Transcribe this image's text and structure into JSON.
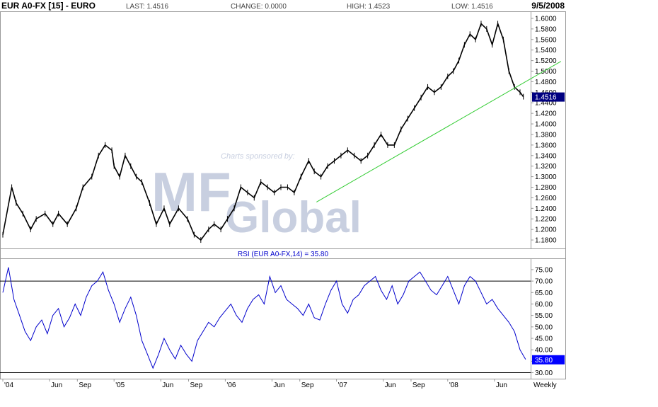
{
  "header": {
    "symbol": "EUR A0-FX [15] - EURO",
    "last": "LAST: 1.4516",
    "change": "CHANGE: 0.0000",
    "high": "HIGH: 1.4523",
    "low": "LOW: 1.4516",
    "date": "9/5/2008"
  },
  "watermark": {
    "sponsor_text": "Charts sponsored by:",
    "logo_letters": "MF",
    "logo_word": "Global"
  },
  "rsi_label": "RSI (EUR A0-FX,14) = 35.80",
  "x_axis_labels": [
    {
      "label": "'04",
      "t": 0.0
    },
    {
      "label": "Jun",
      "t": 0.42
    },
    {
      "label": "Sep",
      "t": 0.67
    },
    {
      "label": "'05",
      "t": 1.0
    },
    {
      "label": "Jun",
      "t": 1.42
    },
    {
      "label": "Sep",
      "t": 1.67
    },
    {
      "label": "'06",
      "t": 2.0
    },
    {
      "label": "Jun",
      "t": 2.42
    },
    {
      "label": "Sep",
      "t": 2.67
    },
    {
      "label": "'07",
      "t": 3.0
    },
    {
      "label": "Jun",
      "t": 3.42
    },
    {
      "label": "Sep",
      "t": 3.67
    },
    {
      "label": "'08",
      "t": 4.0
    },
    {
      "label": "Jun",
      "t": 4.42
    }
  ],
  "period_label": "Weekly",
  "colors": {
    "price": "#000000",
    "trendline": "#33cc33",
    "rsi_line": "#0000cc",
    "last_tag_bg": "#000080",
    "rsi_tag_bg": "#0000ff",
    "watermark": "#c8cfe0",
    "frame": "#999999"
  },
  "chart_data": [
    {
      "type": "line",
      "title": "EUR A0-FX [15] - EURO",
      "x_unit": "years since Jan 2004 (weekly bars)",
      "ylim": [
        1.168,
        1.608
      ],
      "y_ticks": [
        1.18,
        1.2,
        1.22,
        1.24,
        1.26,
        1.28,
        1.3,
        1.32,
        1.34,
        1.36,
        1.38,
        1.4,
        1.42,
        1.44,
        1.46,
        1.48,
        1.5,
        1.52,
        1.54,
        1.56,
        1.58,
        1.6
      ],
      "last_value": 1.4516,
      "series": [
        {
          "name": "EUR A0-FX",
          "x": [
            0,
            0.08,
            0.12,
            0.18,
            0.25,
            0.3,
            0.38,
            0.45,
            0.5,
            0.58,
            0.66,
            0.72,
            0.8,
            0.86,
            0.92,
            0.98,
            1.0,
            1.05,
            1.1,
            1.15,
            1.2,
            1.25,
            1.32,
            1.38,
            1.45,
            1.5,
            1.58,
            1.66,
            1.72,
            1.78,
            1.85,
            1.9,
            1.96,
            2.02,
            2.08,
            2.14,
            2.2,
            2.26,
            2.32,
            2.38,
            2.44,
            2.5,
            2.56,
            2.62,
            2.68,
            2.75,
            2.8,
            2.86,
            2.92,
            2.98,
            3.04,
            3.1,
            3.16,
            3.22,
            3.28,
            3.34,
            3.4,
            3.46,
            3.52,
            3.58,
            3.64,
            3.7,
            3.76,
            3.82,
            3.88,
            3.94,
            4.0,
            4.05,
            4.1,
            4.15,
            4.2,
            4.25,
            4.3,
            4.35,
            4.4,
            4.45,
            4.5,
            4.55,
            4.6,
            4.65,
            4.68
          ],
          "values": [
            1.19,
            1.28,
            1.25,
            1.23,
            1.2,
            1.22,
            1.23,
            1.21,
            1.23,
            1.21,
            1.24,
            1.28,
            1.3,
            1.34,
            1.36,
            1.35,
            1.32,
            1.3,
            1.34,
            1.32,
            1.3,
            1.29,
            1.25,
            1.21,
            1.24,
            1.21,
            1.24,
            1.22,
            1.19,
            1.18,
            1.2,
            1.21,
            1.2,
            1.22,
            1.24,
            1.28,
            1.27,
            1.26,
            1.29,
            1.28,
            1.27,
            1.28,
            1.28,
            1.27,
            1.3,
            1.33,
            1.31,
            1.3,
            1.32,
            1.33,
            1.34,
            1.35,
            1.34,
            1.33,
            1.34,
            1.36,
            1.38,
            1.36,
            1.36,
            1.39,
            1.41,
            1.43,
            1.45,
            1.47,
            1.46,
            1.47,
            1.49,
            1.5,
            1.52,
            1.55,
            1.57,
            1.56,
            1.59,
            1.58,
            1.55,
            1.59,
            1.56,
            1.5,
            1.47,
            1.46,
            1.4516
          ]
        },
        {
          "name": "Trendline",
          "x": [
            2.82,
            4.7
          ],
          "values": [
            1.252,
            1.48
          ]
        }
      ]
    },
    {
      "type": "line",
      "title": "RSI (EUR A0-FX,14) = 35.80",
      "ylim": [
        28,
        79
      ],
      "y_ticks": [
        30,
        35,
        40,
        45,
        50,
        55,
        60,
        65,
        70,
        75
      ],
      "reference_lines": [
        70,
        30
      ],
      "last_value": 35.8,
      "series": [
        {
          "name": "RSI (EUR A0-FX,14)",
          "x": [
            0,
            0.05,
            0.1,
            0.15,
            0.2,
            0.25,
            0.3,
            0.35,
            0.4,
            0.45,
            0.5,
            0.55,
            0.6,
            0.65,
            0.7,
            0.75,
            0.8,
            0.85,
            0.9,
            0.95,
            1.0,
            1.05,
            1.1,
            1.15,
            1.2,
            1.25,
            1.3,
            1.35,
            1.4,
            1.45,
            1.5,
            1.55,
            1.6,
            1.65,
            1.7,
            1.75,
            1.8,
            1.85,
            1.9,
            1.95,
            2.0,
            2.05,
            2.1,
            2.15,
            2.2,
            2.25,
            2.3,
            2.35,
            2.4,
            2.45,
            2.5,
            2.55,
            2.6,
            2.65,
            2.7,
            2.75,
            2.8,
            2.85,
            2.9,
            2.95,
            3.0,
            3.05,
            3.1,
            3.15,
            3.2,
            3.25,
            3.3,
            3.35,
            3.4,
            3.45,
            3.5,
            3.55,
            3.6,
            3.65,
            3.7,
            3.75,
            3.8,
            3.85,
            3.9,
            3.95,
            4.0,
            4.05,
            4.1,
            4.15,
            4.2,
            4.25,
            4.3,
            4.35,
            4.4,
            4.45,
            4.5,
            4.55,
            4.6,
            4.65,
            4.7
          ],
          "values": [
            65,
            76,
            62,
            55,
            48,
            44,
            50,
            53,
            47,
            55,
            58,
            50,
            54,
            60,
            55,
            63,
            68,
            70,
            74,
            66,
            60,
            52,
            58,
            63,
            55,
            44,
            38,
            32,
            38,
            45,
            40,
            36,
            42,
            38,
            35,
            44,
            48,
            52,
            50,
            54,
            57,
            60,
            55,
            52,
            58,
            62,
            64,
            60,
            72,
            65,
            68,
            62,
            60,
            58,
            55,
            60,
            54,
            53,
            60,
            66,
            70,
            60,
            56,
            62,
            64,
            68,
            70,
            72,
            66,
            62,
            68,
            60,
            64,
            70,
            72,
            74,
            70,
            66,
            64,
            68,
            72,
            66,
            60,
            68,
            72,
            70,
            65,
            60,
            62,
            58,
            55,
            52,
            48,
            40,
            35.8
          ]
        }
      ]
    }
  ]
}
